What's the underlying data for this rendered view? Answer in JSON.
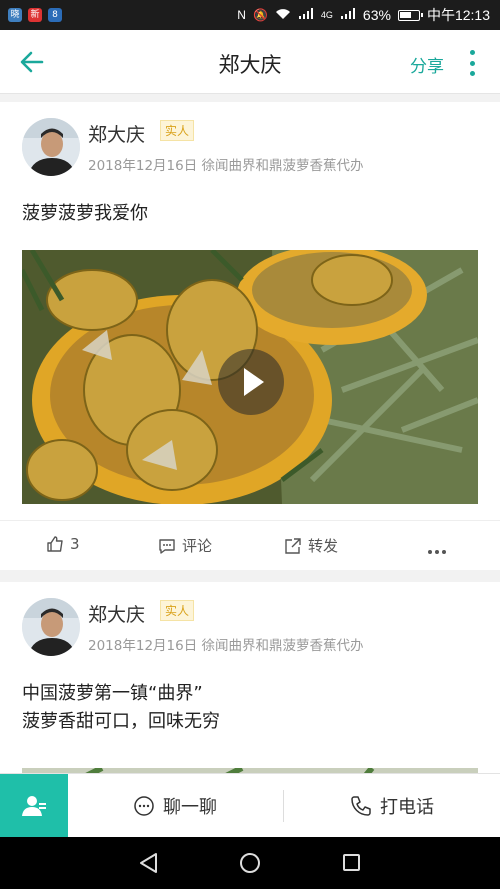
{
  "status_bar": {
    "apps": [
      "晓",
      "新",
      "8"
    ],
    "signal_4g": "4G",
    "battery": "63%",
    "battery_level": 0.63,
    "time": "中午12:13"
  },
  "header": {
    "title": "郑大庆",
    "share_label": "分享"
  },
  "posts": [
    {
      "author": "郑大庆",
      "badge": "实人",
      "date": "2018年12月16日",
      "location": "徐闻曲界和鼎菠萝香蕉代办",
      "text_lines": [
        "菠萝菠萝我爱你"
      ],
      "likes": "3",
      "comment_label": "评论",
      "forward_label": "转发",
      "has_video": true
    },
    {
      "author": "郑大庆",
      "badge": "实人",
      "date": "2018年12月16日",
      "location": "徐闻曲界和鼎菠萝香蕉代办",
      "text_lines": [
        "中国菠萝第一镇“曲界”",
        "菠萝香甜可口，回味无穷"
      ]
    }
  ],
  "bottom_bar": {
    "chat_label": "聊一聊",
    "call_label": "打电话"
  },
  "colors": {
    "accent": "#1aa89b",
    "contact_button": "#1fbfa9",
    "badge_text": "#d9a21b"
  },
  "icons": [
    "back-arrow-icon",
    "more-vertical-icon",
    "thumbs-up-icon",
    "comment-icon",
    "share-out-icon",
    "ellipsis-icon",
    "user-icon",
    "chat-bubble-icon",
    "phone-icon",
    "play-icon"
  ]
}
